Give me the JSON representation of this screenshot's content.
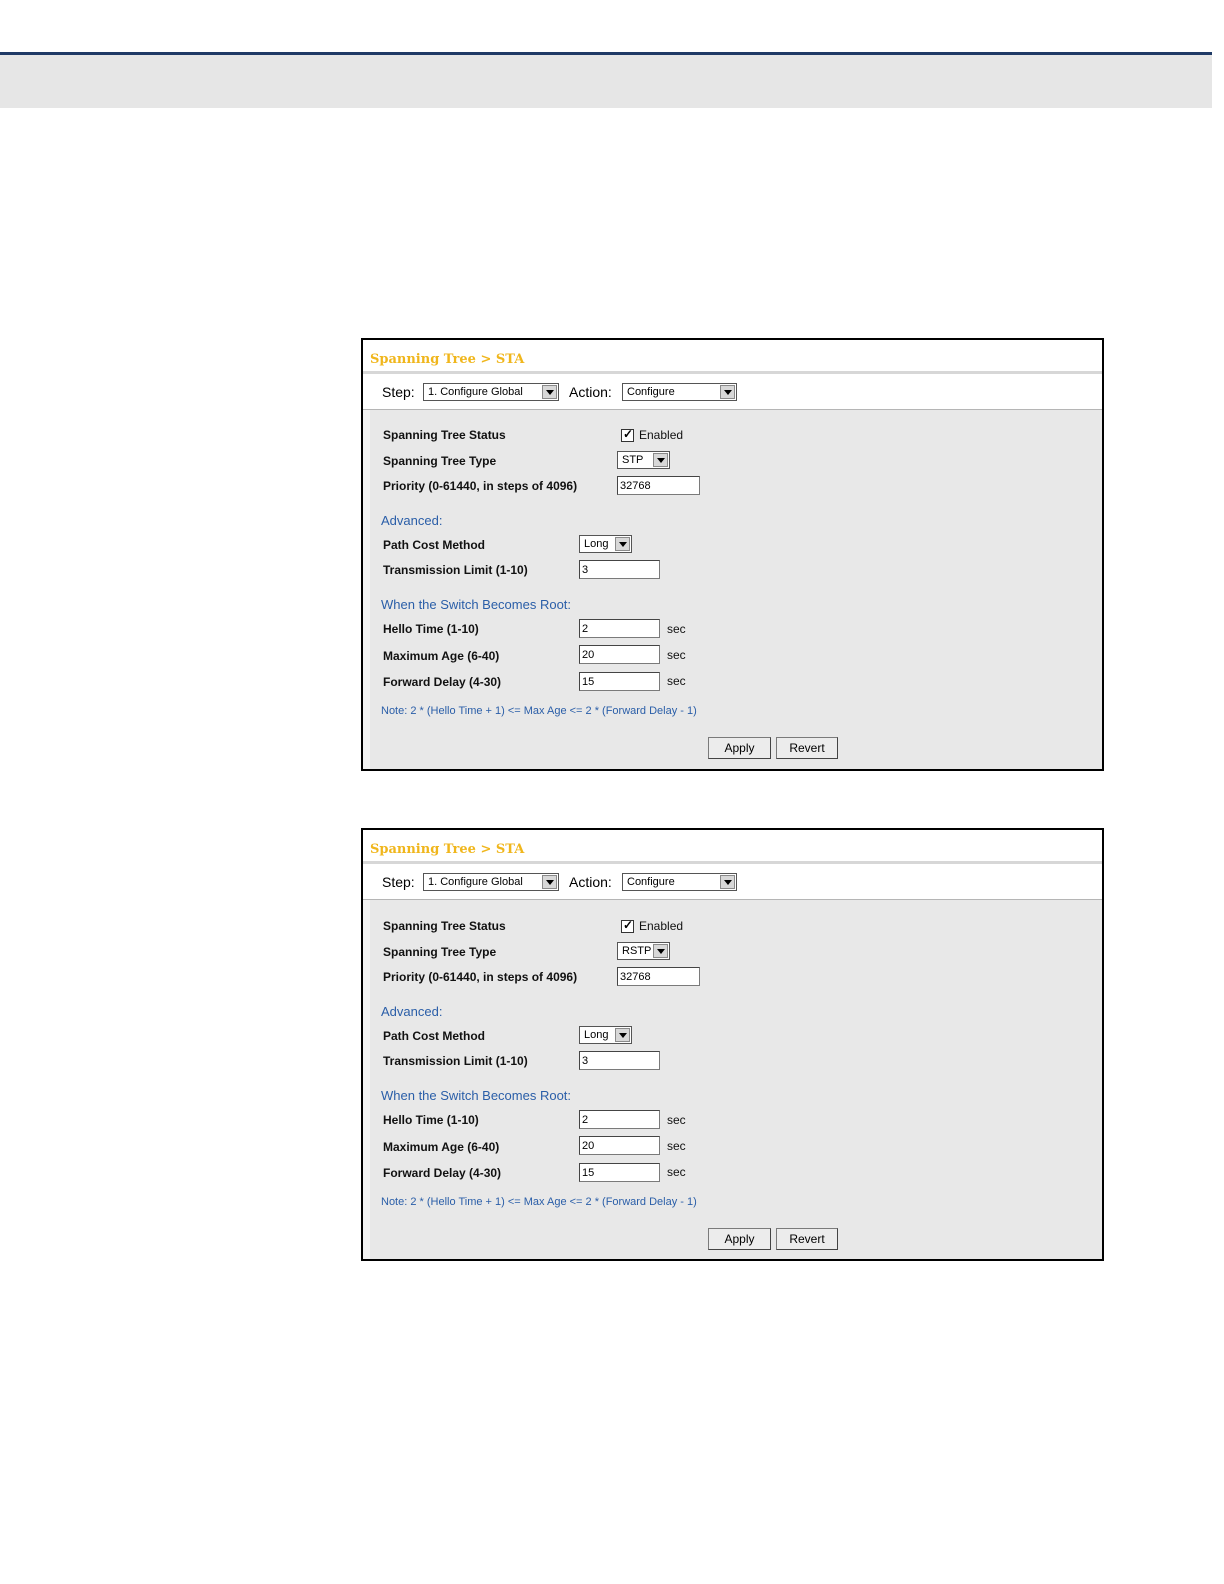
{
  "screens": [
    {
      "title": "Spanning Tree > STA",
      "step_label": "Step:",
      "step_value": "1. Configure Global",
      "action_label": "Action:",
      "action_value": "Configure",
      "status_label": "Spanning Tree Status",
      "status_checkbox_label": "Enabled",
      "status_checked": true,
      "type_label": "Spanning Tree Type",
      "type_value": "STP",
      "priority_label": "Priority (0-61440, in steps of 4096)",
      "priority_value": "32768",
      "advanced_heading": "Advanced:",
      "path_cost_label": "Path Cost Method",
      "path_cost_value": "Long",
      "tx_limit_label": "Transmission Limit (1-10)",
      "tx_limit_value": "3",
      "root_heading": "When the Switch Becomes Root:",
      "hello_label": "Hello Time (1-10)",
      "hello_value": "2",
      "max_age_label": "Maximum Age (6-40)",
      "max_age_value": "20",
      "fwd_delay_label": "Forward Delay (4-30)",
      "fwd_delay_value": "15",
      "unit": "sec",
      "note": "Note: 2 * (Hello Time + 1) <= Max Age <= 2 * (Forward Delay - 1)",
      "apply_label": "Apply",
      "revert_label": "Revert"
    },
    {
      "title": "Spanning Tree > STA",
      "step_label": "Step:",
      "step_value": "1. Configure Global",
      "action_label": "Action:",
      "action_value": "Configure",
      "status_label": "Spanning Tree Status",
      "status_checkbox_label": "Enabled",
      "status_checked": true,
      "type_label": "Spanning Tree Type",
      "type_value": "RSTP",
      "priority_label": "Priority (0-61440, in steps of 4096)",
      "priority_value": "32768",
      "advanced_heading": "Advanced:",
      "path_cost_label": "Path Cost Method",
      "path_cost_value": "Long",
      "tx_limit_label": "Transmission Limit (1-10)",
      "tx_limit_value": "3",
      "root_heading": "When the Switch Becomes Root:",
      "hello_label": "Hello Time (1-10)",
      "hello_value": "2",
      "max_age_label": "Maximum Age (6-40)",
      "max_age_value": "20",
      "fwd_delay_label": "Forward Delay (4-30)",
      "fwd_delay_value": "15",
      "unit": "sec",
      "note": "Note: 2 * (Hello Time + 1) <= Max Age <= 2 * (Forward Delay - 1)",
      "apply_label": "Apply",
      "revert_label": "Revert"
    }
  ],
  "colors": {
    "title": "#f0b61c",
    "section": "#2a5ea8",
    "top_rule": "#1f3a66",
    "top_band": "#e6e6e6"
  }
}
